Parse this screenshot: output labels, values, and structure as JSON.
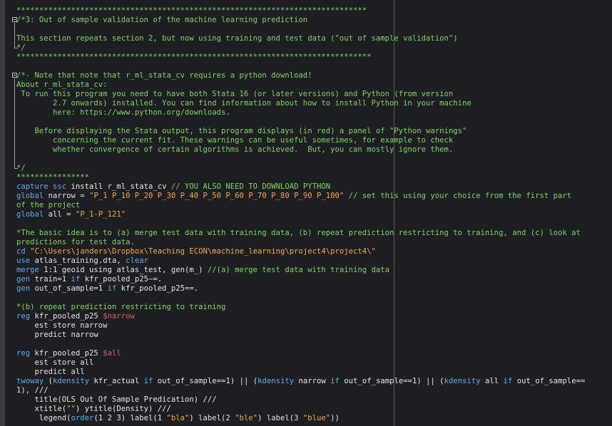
{
  "editor": {
    "colors": {
      "background": "#1e1f22",
      "comment": "#7bd35c",
      "keyword": "#5fa8e6",
      "string": "#f0a63c",
      "macro": "#e05a5a",
      "text": "#e2e2e2"
    },
    "fold_markers": [
      "fold-toggle-icon",
      "fold-toggle-icon"
    ]
  },
  "lines": [
    [
      {
        "t": "*****************************************************************************",
        "c": "c"
      }
    ],
    [
      {
        "t": "/*3: Out of sample validation of the machine learning prediction",
        "c": "c"
      }
    ],
    [],
    [
      {
        "t": "This section repeats section 2, but now using training and test data (\"out of sample validation\")",
        "c": "c"
      }
    ],
    [
      {
        "t": "*/",
        "c": "c"
      }
    ],
    [
      {
        "t": "******************************************************************************",
        "c": "c"
      }
    ],
    [],
    [
      {
        "t": "/*- Note that note that r_ml_stata_cv requires a python download!",
        "c": "c"
      }
    ],
    [
      {
        "t": "About r_ml_stata_cv:",
        "c": "c"
      }
    ],
    [
      {
        "t": " To run this program you need to have both Stata 16 (or later versions) and Python (from version",
        "c": "c"
      }
    ],
    [
      {
        "t": "        2.7 onwards) installed. You can find information about how to install Python in your machine",
        "c": "c"
      }
    ],
    [
      {
        "t": "        here: https://www.python.org/downloads.",
        "c": "c"
      }
    ],
    [],
    [
      {
        "t": "    Before displaying the Stata output, this program displays (in red) a panel of \"Python warnings\"",
        "c": "c"
      }
    ],
    [
      {
        "t": "        concerning the current fit. These warnings can be useful sometimes, for example to check",
        "c": "c"
      }
    ],
    [
      {
        "t": "        whether convergence of certain algorithms is achieved.  But, you can mostly ignore them.",
        "c": "c"
      }
    ],
    [],
    [
      {
        "t": "*/",
        "c": "c"
      }
    ],
    [
      {
        "t": "****************",
        "c": "c"
      }
    ],
    [
      {
        "t": "capture ssc",
        "c": "kw"
      },
      {
        "t": " install r_ml_stata_cv "
      },
      {
        "t": "// YOU ALSO NEED TO DOWNLOAD PYTHON",
        "c": "c"
      }
    ],
    [
      {
        "t": "global",
        "c": "kw"
      },
      {
        "t": " narrow = "
      },
      {
        "t": "\"P_1 P_10 P_20 P_30 P_40 P_50 P_60 P_70 P_80 P_90 P_100\"",
        "c": "st"
      },
      {
        "t": " // set this using your choice from the first part",
        "c": "c"
      }
    ],
    [
      {
        "t": "of the project",
        "c": "c"
      }
    ],
    [
      {
        "t": "global",
        "c": "kw"
      },
      {
        "t": " all = "
      },
      {
        "t": "\"P_1-P_121\"",
        "c": "st"
      }
    ],
    [],
    [
      {
        "t": "*The basic idea is to (a) merge test data with training data, (b) repeat prediction restricting to training, and (c) look at",
        "c": "c"
      }
    ],
    [
      {
        "t": "predictions for test data.",
        "c": "c"
      }
    ],
    [
      {
        "t": "cd",
        "c": "kw"
      },
      {
        "t": " "
      },
      {
        "t": "\"C:\\Users\\janders\\Dropbox\\Teaching ECON\\machine_learning\\project4\\project4\\\"",
        "c": "st"
      }
    ],
    [
      {
        "t": "use",
        "c": "kw"
      },
      {
        "t": " atlas_training.dta, "
      },
      {
        "t": "clear",
        "c": "kw"
      }
    ],
    [
      {
        "t": "merge",
        "c": "kw"
      },
      {
        "t": " 1:1 geoid using atlas_test, gen(m_) "
      },
      {
        "t": "//(a) merge test data with training data",
        "c": "c"
      }
    ],
    [
      {
        "t": "gen",
        "c": "kw"
      },
      {
        "t": " train=1 "
      },
      {
        "t": "if",
        "c": "kw"
      },
      {
        "t": " kfr_pooled_p25~=."
      }
    ],
    [
      {
        "t": "gen",
        "c": "kw"
      },
      {
        "t": " out_of_sample=1 "
      },
      {
        "t": "if",
        "c": "kw"
      },
      {
        "t": " kfr_pooled_p25==."
      }
    ],
    [],
    [
      {
        "t": "*(b) repeat prediction restricting to training",
        "c": "c"
      }
    ],
    [
      {
        "t": "reg",
        "c": "kw"
      },
      {
        "t": " kfr_pooled_p25 "
      },
      {
        "t": "$narrow",
        "c": "mac"
      }
    ],
    [
      {
        "t": "    est store narrow"
      }
    ],
    [
      {
        "t": "    predict narrow"
      }
    ],
    [],
    [
      {
        "t": "reg",
        "c": "kw"
      },
      {
        "t": " kfr_pooled_p25 "
      },
      {
        "t": "$all",
        "c": "mac"
      }
    ],
    [
      {
        "t": "    est store all"
      }
    ],
    [
      {
        "t": "    predict all"
      }
    ],
    [
      {
        "t": "twoway",
        "c": "kw"
      },
      {
        "t": " ("
      },
      {
        "t": "kdensity",
        "c": "kw"
      },
      {
        "t": " kfr_actual "
      },
      {
        "t": "if",
        "c": "kw"
      },
      {
        "t": " out_of_sample==1) || ("
      },
      {
        "t": "kdensity",
        "c": "kw"
      },
      {
        "t": " narrow "
      },
      {
        "t": "if",
        "c": "kw"
      },
      {
        "t": " out_of_sample==1) || ("
      },
      {
        "t": "kdensity",
        "c": "kw"
      },
      {
        "t": " all "
      },
      {
        "t": "if",
        "c": "kw"
      },
      {
        "t": " out_of_sample=="
      }
    ],
    [
      {
        "t": "1), ///"
      }
    ],
    [
      {
        "t": "    title(OLS Out Of Sample Predication) ///"
      }
    ],
    [
      {
        "t": "    xtitle("
      },
      {
        "t": "\"\"",
        "c": "st"
      },
      {
        "t": ") ytitle(Density) ///"
      }
    ],
    [
      {
        "t": "     legend("
      },
      {
        "t": "order",
        "c": "kw"
      },
      {
        "t": "(1 2 3) label(1 "
      },
      {
        "t": "\"bla\"",
        "c": "st"
      },
      {
        "t": ") label(2 "
      },
      {
        "t": "\"ble\"",
        "c": "st"
      },
      {
        "t": ") label(3 "
      },
      {
        "t": "\"blue\"",
        "c": "st"
      },
      {
        "t": "))"
      }
    ]
  ]
}
